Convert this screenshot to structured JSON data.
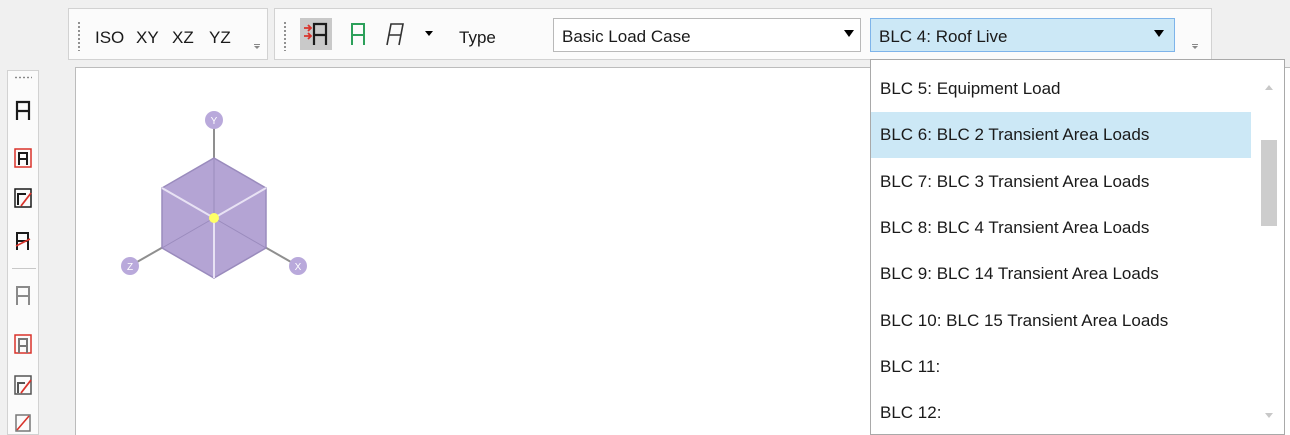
{
  "view_toolbar": {
    "views": [
      "ISO",
      "XY",
      "XZ",
      "YZ"
    ]
  },
  "load_toolbar": {
    "type_label": "Type",
    "type_value": "Basic Load Case",
    "case_value": "BLC 4: Roof Live"
  },
  "case_list": [
    {
      "label": "BLC 5: Equipment Load",
      "selected": false
    },
    {
      "label": "BLC 6: BLC 2 Transient Area Loads",
      "selected": true
    },
    {
      "label": "BLC 7: BLC 3 Transient Area Loads",
      "selected": false
    },
    {
      "label": "BLC 8: BLC 4 Transient Area Loads",
      "selected": false
    },
    {
      "label": "BLC 9: BLC 14 Transient Area Loads",
      "selected": false
    },
    {
      "label": "BLC 10: BLC 15 Transient Area Loads",
      "selected": false
    },
    {
      "label": "BLC 11:",
      "selected": false
    },
    {
      "label": "BLC 12:",
      "selected": false
    }
  ],
  "axes": {
    "y": "Y",
    "x": "X",
    "z": "Z"
  },
  "colors": {
    "accent_selection": "#cce8f6",
    "cube_fill": "#b4a4d4",
    "axis_badge": "#b9a9db",
    "red_icon": "#d9332b",
    "green_icon": "#2ca05a"
  },
  "icons": {
    "vertical_toolbar": [
      "plate-icon",
      "plate-red-box-icon",
      "plate-red-slash-icon",
      "plate-red-line-icon",
      "plate-gray-icon",
      "plate-gray-red-box-icon",
      "plate-gray-red-slash-icon",
      "plate-gray-red-x-icon"
    ]
  }
}
